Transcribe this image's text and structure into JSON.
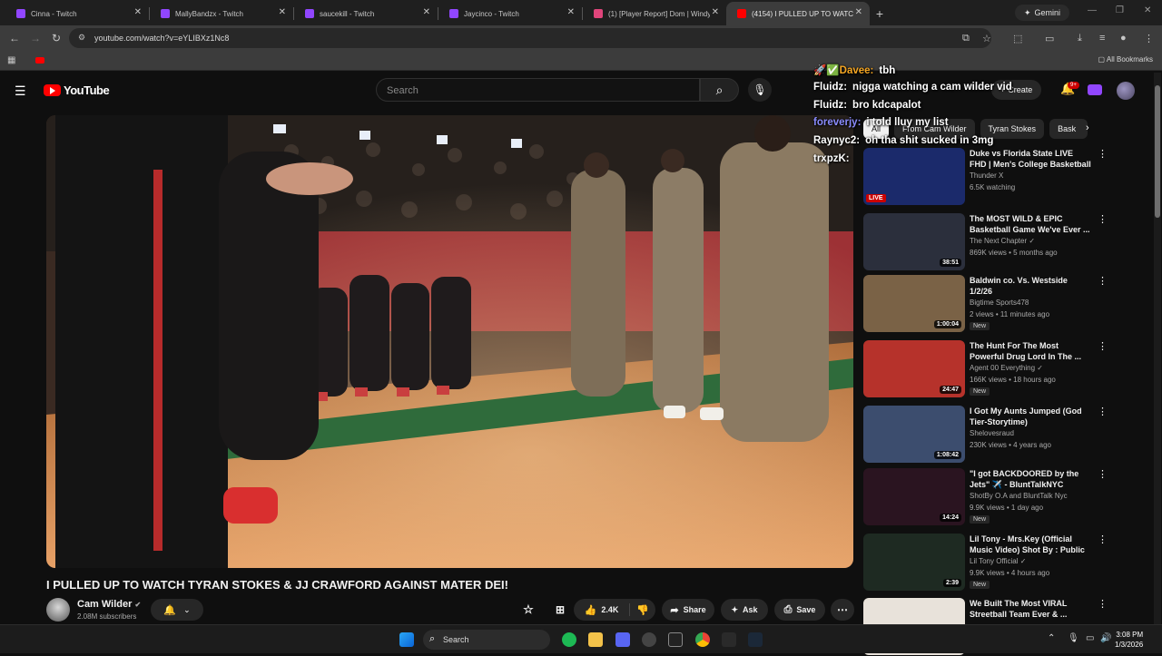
{
  "browser": {
    "tabs": [
      {
        "title": "Cinna - Twitch",
        "color": "#9146ff"
      },
      {
        "title": "MallyBandzx - Twitch",
        "color": "#9146ff"
      },
      {
        "title": "saucekill - Twitch",
        "color": "#9146ff"
      },
      {
        "title": "Jaycinco - Twitch",
        "color": "#9146ff"
      },
      {
        "title": "(1) [Player Report] Dom | Windy",
        "color": "#e0457b"
      },
      {
        "title": "(4154) I PULLED UP TO WATCH",
        "color": "#ff0000"
      }
    ],
    "gemini_label": "Gemini",
    "url": "youtube.com/watch?v=eYLIBXz1Nc8",
    "all_bookmarks": "All Bookmarks"
  },
  "youtube": {
    "logo_text": "YouTube",
    "search_placeholder": "Search",
    "create_label": "Create",
    "notif_count": "9+"
  },
  "chat": [
    {
      "user": "🚀✅Davee:",
      "message": "tbh",
      "color": "#f5a623"
    },
    {
      "user": "Fluidz:",
      "message": "nigga watching a cam wilder vid",
      "color": "#ffffff"
    },
    {
      "user": "Fluidz:",
      "message": "bro kdcapalot",
      "color": "#ffffff"
    },
    {
      "user": "foreverjy:",
      "message": "i told lluy my list",
      "color": "#8a8cff"
    },
    {
      "user": "Raynyc2:",
      "message": "oh tha shit sucked in 3mg",
      "color": "#ffffff"
    },
    {
      "user": "trxpzK:",
      "message": "",
      "color": "#ffffff"
    }
  ],
  "video": {
    "title": "I PULLED UP TO WATCH TYRAN STOKES & JJ CRAWFORD AGAINST MATER DEI!",
    "channel": "Cam Wilder",
    "subscribers": "2.08M subscribers",
    "likes": "2.4K",
    "share_label": "Share",
    "ask_label": "Ask",
    "save_label": "Save"
  },
  "chips": [
    "All",
    "From Cam Wilder",
    "Tyran Stokes",
    "Bask"
  ],
  "recommendations": [
    {
      "title": "Duke vs Florida State LIVE FHD | Men's College Basketball 2026",
      "channel": "Thunder X",
      "meta": "6.5K watching",
      "duration": "",
      "live": "LIVE",
      "badge": "",
      "thumb": "#1b2a6b"
    },
    {
      "title": "The MOST WILD & EPIC Basketball Game We've Ever ...",
      "channel": "The Next Chapter ✓",
      "meta": "869K views • 5 months ago",
      "duration": "38:51",
      "live": "",
      "badge": "",
      "thumb": "#2b2f3c"
    },
    {
      "title": "Baldwin co.  Vs. Westside 1/2/26",
      "channel": "Bigtime Sports478",
      "meta": "2 views • 11 minutes ago",
      "duration": "1:00:04",
      "live": "",
      "badge": "New",
      "thumb": "#7a6246"
    },
    {
      "title": "The Hunt For The Most Powerful Drug Lord In The ...",
      "channel": "Agent 00 Everything ✓",
      "meta": "166K views • 18 hours ago",
      "duration": "24:47",
      "live": "",
      "badge": "New",
      "thumb": "#b6322b"
    },
    {
      "title": "I Got My Aunts Jumped (God Tier-Storytime)",
      "channel": "Shelovesraud",
      "meta": "230K views • 4 years ago",
      "duration": "1:08:42",
      "live": "",
      "badge": "",
      "thumb": "#3c4d6e"
    },
    {
      "title": "\"I got BACKDOORED by the Jets\" ✈️ - BluntTalkNYC",
      "channel": "ShotBy O.A and BluntTalk Nyc",
      "meta": "9.9K views • 1 day ago",
      "duration": "14:24",
      "live": "",
      "badge": "New",
      "thumb": "#2a1420"
    },
    {
      "title": "Lil Tony - Mrs.Key (Official Music Video) Shot By : Public ...",
      "channel": "Lil Tony Official ✓",
      "meta": "9.9K views • 4 hours ago",
      "duration": "2:39",
      "live": "",
      "badge": "New",
      "thumb": "#1e2a22"
    },
    {
      "title": "We Built The Most VIRAL Streetball Team Ever & ...",
      "channel": "",
      "meta": "",
      "duration": "",
      "live": "",
      "badge": "",
      "thumb": "#e8e2da"
    }
  ],
  "taskbar": {
    "search_label": "Search",
    "time": "3:08 PM",
    "date": "1/3/2026"
  }
}
